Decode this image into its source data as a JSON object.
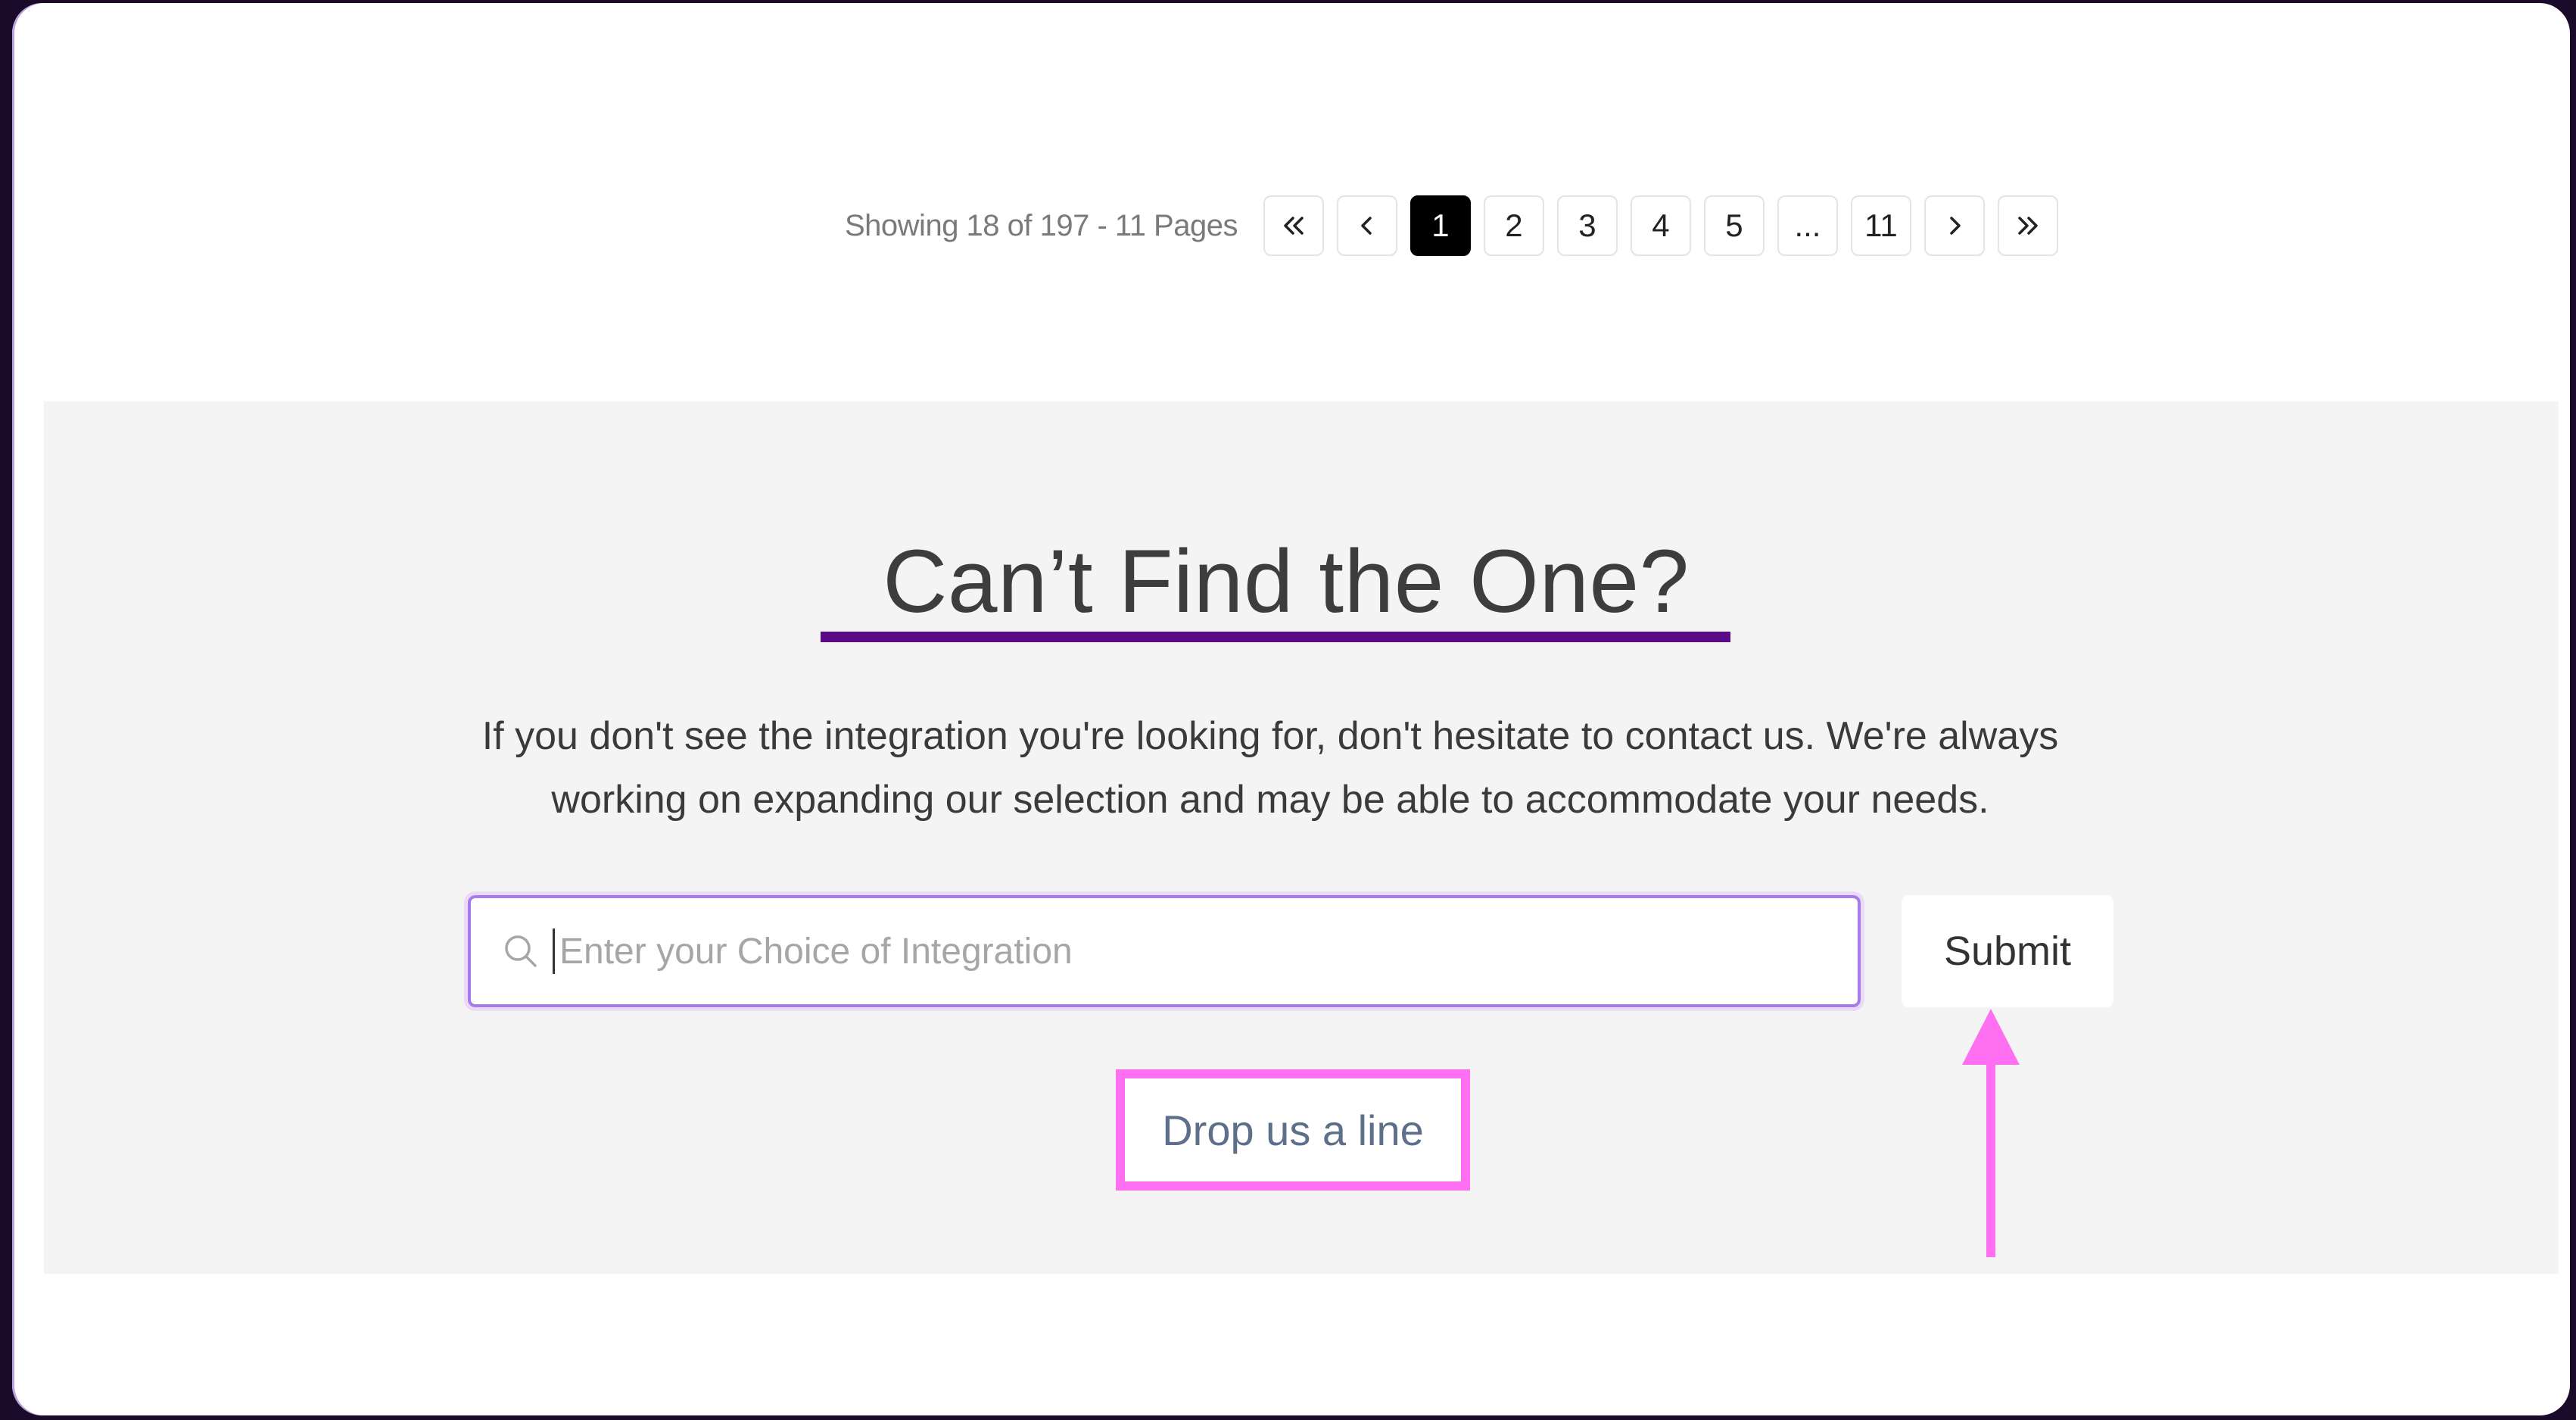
{
  "pagination": {
    "info": "Showing 18 of 197 - 11 Pages",
    "first_icon": "double-chevron-left-icon",
    "prev_icon": "chevron-left-icon",
    "next_icon": "chevron-right-icon",
    "last_icon": "double-chevron-right-icon",
    "pages": [
      "1",
      "2",
      "3",
      "4",
      "5",
      "...",
      "11"
    ],
    "current_page": "1"
  },
  "cta": {
    "title": "Can’t Find the One?",
    "description_line1": "If you don't see the integration you're looking for, don't hesitate to contact us. We're always",
    "description_line2": "working on expanding our selection and may be able to accommodate your needs.",
    "search_placeholder": "Enter your Choice of Integration",
    "search_value": "",
    "search_icon": "search-icon",
    "submit_label": "Submit",
    "drop_line_label": "Drop us a line"
  },
  "colors": {
    "accent_underline": "#5b0a86",
    "highlight_annotation": "#ff6ff2",
    "input_border": "#a77be6",
    "section_bg": "#f4f4f5"
  }
}
